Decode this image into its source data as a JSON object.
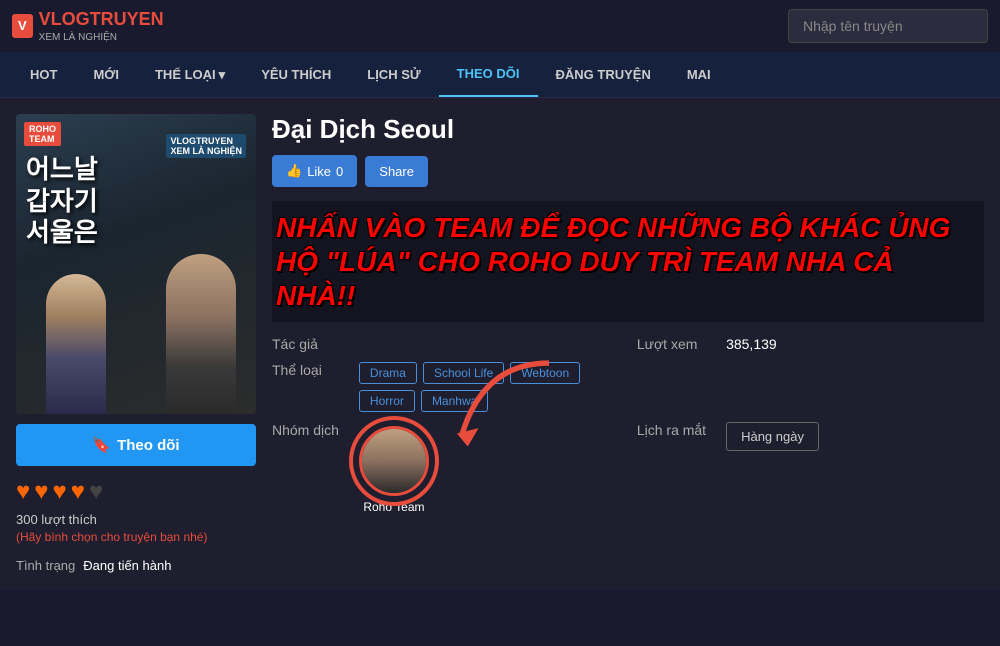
{
  "header": {
    "logo_main": "VLOGTRUYEN",
    "logo_sub": "XEM LÀ NGHIỆN",
    "logo_v": "V",
    "search_placeholder": "Nhập tên truyện"
  },
  "nav": {
    "items": [
      {
        "id": "hot",
        "label": "HOT"
      },
      {
        "id": "moi",
        "label": "MỚI"
      },
      {
        "id": "the-loai",
        "label": "THỂ LOẠI",
        "has_dropdown": true
      },
      {
        "id": "yeu-thich",
        "label": "YÊU THÍCH"
      },
      {
        "id": "lich-su",
        "label": "LỊCH SỬ"
      },
      {
        "id": "theo-doi",
        "label": "THEO DÕI",
        "active": true
      },
      {
        "id": "dang-truyen",
        "label": "ĐĂNG TRUYỆN"
      },
      {
        "id": "mai",
        "label": "MAI"
      }
    ]
  },
  "manga": {
    "title": "Đại Dịch Seoul",
    "like_label": "Like",
    "like_count": "0",
    "share_label": "Share",
    "promo_text": "NHẤN VÀO TEAM ĐỂ ĐỌC NHỮNG BỘ KHÁC ỦNG HỘ \"LÚA\" CHO ROHO DUY TRÌ TEAM NHA CẢ NHÀ!!",
    "tac_gia_label": "Tác giả",
    "tac_gia_value": "",
    "luot_xem_label": "Lượt xem",
    "luot_xem_value": "385,139",
    "the_loai_label": "Thể loại",
    "tags": [
      "Drama",
      "School Life",
      "Webtoon",
      "Horror",
      "Manhwa"
    ],
    "nhom_dich_label": "Nhóm dịch",
    "lich_ra_mat_label": "Lịch ra mắt",
    "lich_ra_mat_value": "Hàng ngày",
    "group_name": "Roho Team",
    "follow_label": "Theo dõi",
    "stars_filled": 4,
    "stars_total": 5,
    "likes_count": "300",
    "likes_text": "lượt thích",
    "likes_vote_text": "(Hãy bình chọn cho truyện bạn nhé)",
    "tinh_trang_label": "Tình trạng",
    "tinh_trang_value": "Đang tiến hành",
    "bookmark_icon": "🔖"
  }
}
